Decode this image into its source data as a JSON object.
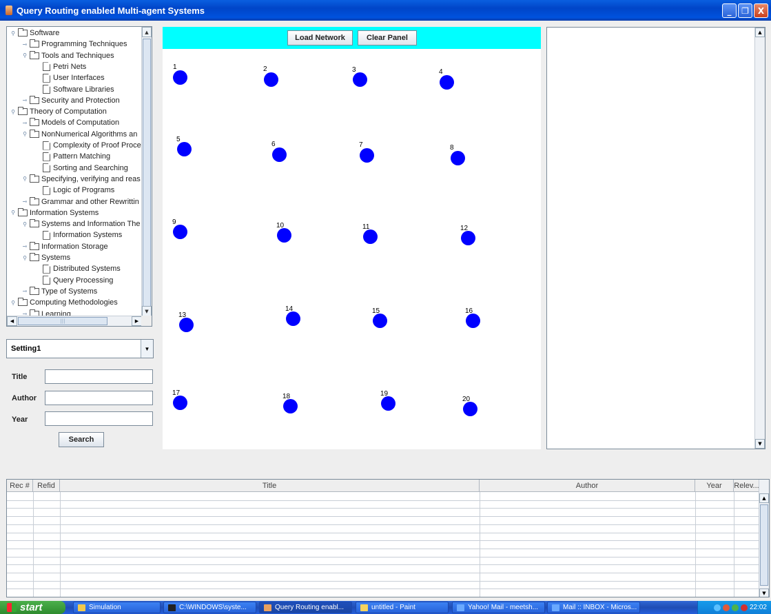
{
  "window": {
    "title": "Query Routing enabled Multi-agent Systems",
    "buttons": {
      "minimize": "_",
      "maximize": "❐",
      "close": "X"
    }
  },
  "tree": {
    "items": [
      {
        "label": "Software",
        "depth": 0,
        "kind": "folder",
        "expanded": true
      },
      {
        "label": "Programming Techniques",
        "depth": 1,
        "kind": "folder",
        "expanded": false
      },
      {
        "label": "Tools and Techniques",
        "depth": 1,
        "kind": "folder",
        "expanded": true
      },
      {
        "label": "Petri Nets",
        "depth": 2,
        "kind": "file"
      },
      {
        "label": "User Interfaces",
        "depth": 2,
        "kind": "file"
      },
      {
        "label": "Software Libraries",
        "depth": 2,
        "kind": "file"
      },
      {
        "label": "Security and Protection",
        "depth": 1,
        "kind": "folder",
        "expanded": false
      },
      {
        "label": "Theory of Computation",
        "depth": 0,
        "kind": "folder",
        "expanded": true
      },
      {
        "label": "Models of Computation",
        "depth": 1,
        "kind": "folder",
        "expanded": false
      },
      {
        "label": "NonNumerical Algorithms an",
        "depth": 1,
        "kind": "folder",
        "expanded": true
      },
      {
        "label": "Complexity of Proof Proce",
        "depth": 2,
        "kind": "file"
      },
      {
        "label": "Pattern Matching",
        "depth": 2,
        "kind": "file"
      },
      {
        "label": "Sorting and Searching",
        "depth": 2,
        "kind": "file"
      },
      {
        "label": "Specifying, verifying and reas",
        "depth": 1,
        "kind": "folder",
        "expanded": true
      },
      {
        "label": "Logic of Programs",
        "depth": 2,
        "kind": "file"
      },
      {
        "label": "Grammar and other Rewrittin",
        "depth": 1,
        "kind": "folder",
        "expanded": false
      },
      {
        "label": "Information Systems",
        "depth": 0,
        "kind": "folder",
        "expanded": true
      },
      {
        "label": "Systems and Information The",
        "depth": 1,
        "kind": "folder",
        "expanded": true
      },
      {
        "label": "Information Systems",
        "depth": 2,
        "kind": "file"
      },
      {
        "label": "Information Storage",
        "depth": 1,
        "kind": "folder",
        "expanded": false
      },
      {
        "label": "Systems",
        "depth": 1,
        "kind": "folder",
        "expanded": true
      },
      {
        "label": "Distributed Systems",
        "depth": 2,
        "kind": "file"
      },
      {
        "label": "Query Processing",
        "depth": 2,
        "kind": "file"
      },
      {
        "label": "Type of Systems",
        "depth": 1,
        "kind": "folder",
        "expanded": false
      },
      {
        "label": "Computing Methodologies",
        "depth": 0,
        "kind": "folder",
        "expanded": true
      },
      {
        "label": "Learning",
        "depth": 1,
        "kind": "folder",
        "expanded": false
      }
    ]
  },
  "settings": {
    "selected": "Setting1"
  },
  "form": {
    "title_label": "Title",
    "title_value": "",
    "author_label": "Author",
    "author_value": "",
    "year_label": "Year",
    "year_value": "",
    "search_button": "Search"
  },
  "network": {
    "load_button": "Load Network",
    "clear_button": "Clear Panel",
    "node_color": "#0000FF",
    "toolbar_color": "#00FFFF",
    "nodes": [
      "1",
      "2",
      "3",
      "4",
      "5",
      "6",
      "7",
      "8",
      "9",
      "10",
      "11",
      "12",
      "13",
      "14",
      "15",
      "16",
      "17",
      "18",
      "19",
      "20"
    ]
  },
  "results_table": {
    "columns": [
      "Rec #",
      "Refid",
      "Title",
      "Author",
      "Year",
      "Relev..."
    ],
    "rows": []
  },
  "taskbar": {
    "start": "start",
    "tasks": [
      "Simulation",
      "C:\\WINDOWS\\syste...",
      "Query Routing enabl...",
      "untitled - Paint",
      "Yahoo! Mail - meetsh...",
      "Mail :: INBOX - Micros..."
    ],
    "clock": "22:02"
  }
}
